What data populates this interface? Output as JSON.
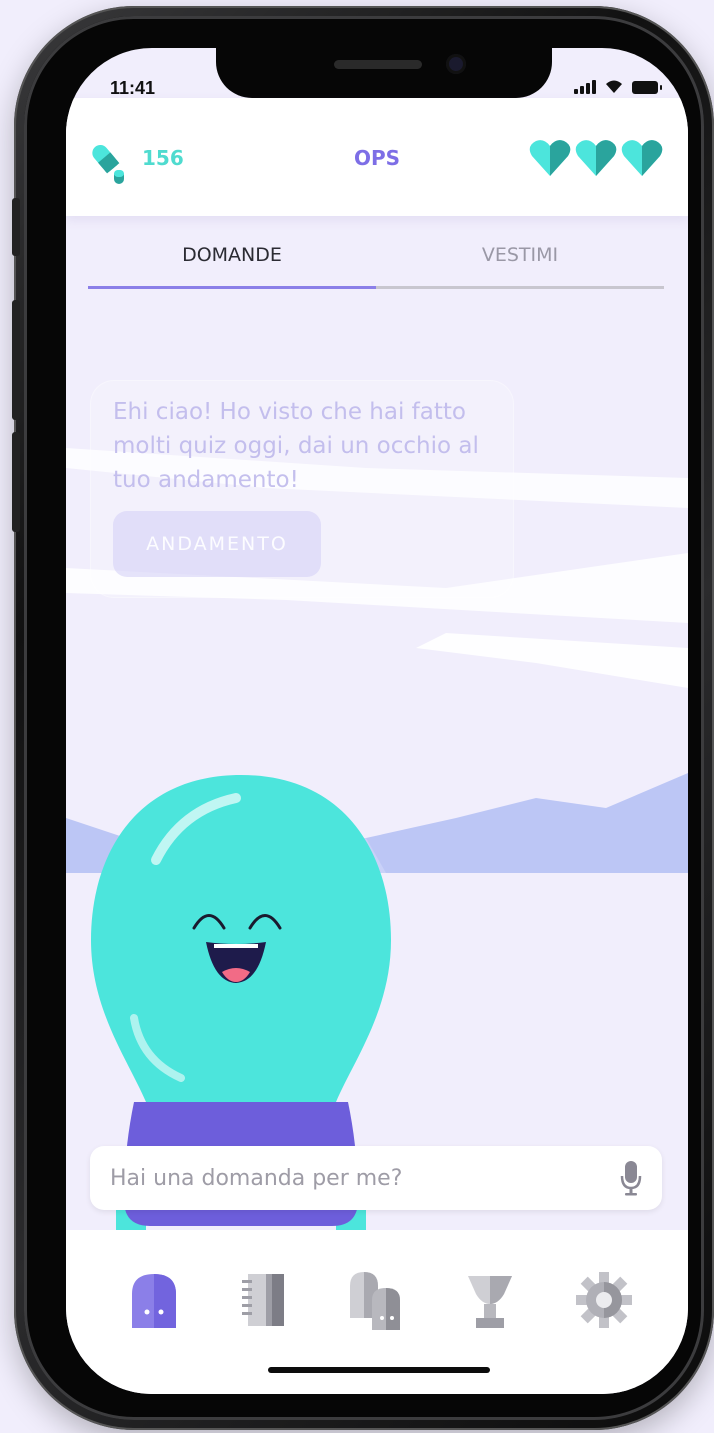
{
  "status_bar": {
    "time": "11:41"
  },
  "header": {
    "score": "156",
    "title": "OPS",
    "lives": 3
  },
  "tabs": [
    {
      "label": "DOMANDE",
      "active": true
    },
    {
      "label": "VESTIMI",
      "active": false
    }
  ],
  "message": {
    "text": "Ehi ciao! Ho visto che hai fatto molti quiz oggi, dai un occhio al tuo andamento!",
    "button_label": "ANDAMENTO"
  },
  "ask": {
    "placeholder": "Hai una domanda per me?"
  },
  "bottom_nav": [
    {
      "name": "home",
      "icon": "door-icon",
      "active": true
    },
    {
      "name": "notebook",
      "icon": "notebook-icon",
      "active": false
    },
    {
      "name": "compare",
      "icon": "doors-icon",
      "active": false
    },
    {
      "name": "trophy",
      "icon": "trophy-icon",
      "active": false
    },
    {
      "name": "settings",
      "icon": "gear-icon",
      "active": false
    }
  ],
  "colors": {
    "accent": "#7d6ee6",
    "teal": "#4ce5dc",
    "background": "#f1eefc",
    "mountain": "#bcc6f5",
    "character_base": "#6d5edb"
  }
}
